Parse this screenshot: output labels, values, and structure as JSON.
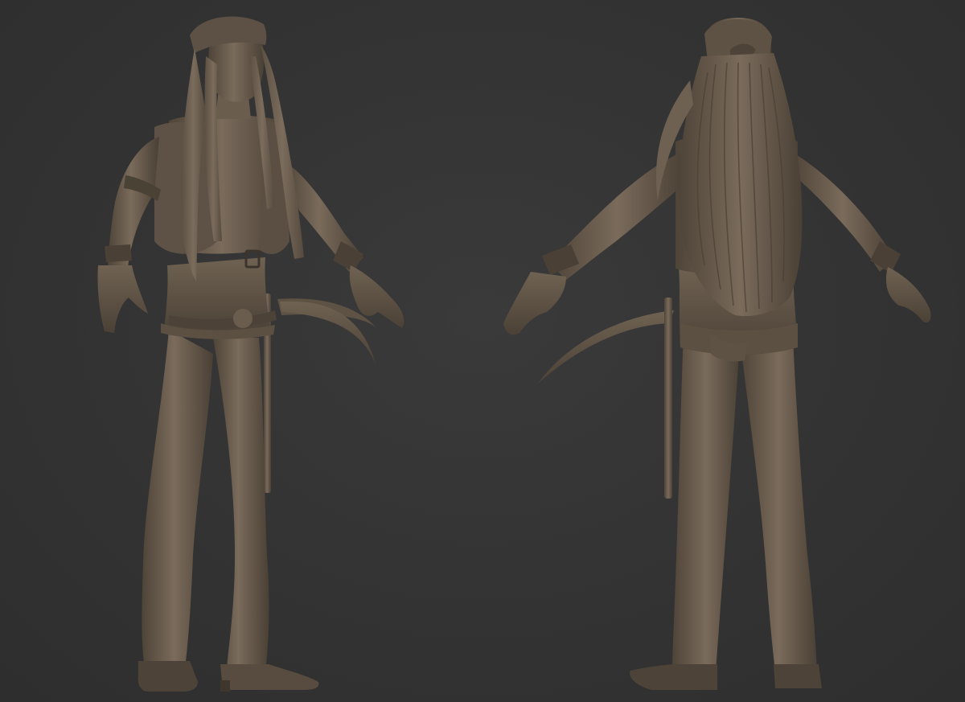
{
  "scene": {
    "background_color": "#333333",
    "material_color": "#6e6152",
    "views": [
      {
        "name": "front-three-quarter",
        "icon": "sculpt-figure-front"
      },
      {
        "name": "back",
        "icon": "sculpt-figure-back"
      }
    ]
  }
}
